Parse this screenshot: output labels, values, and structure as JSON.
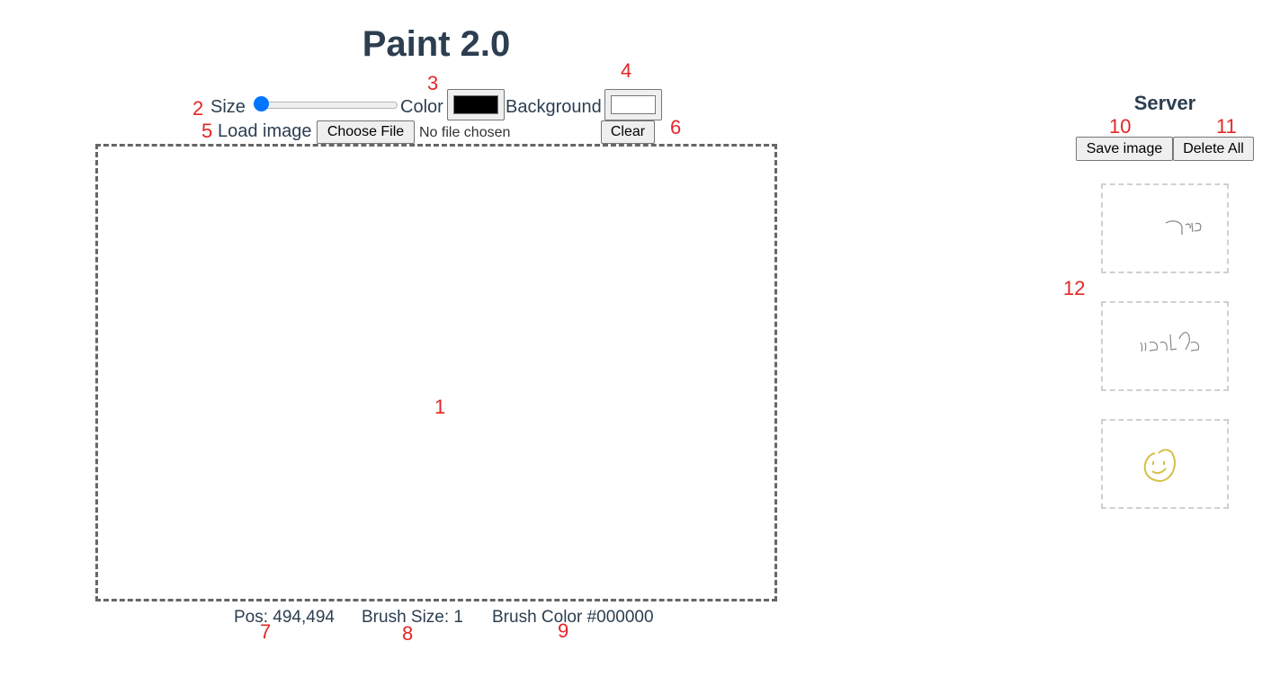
{
  "app": {
    "title": "Paint 2.0"
  },
  "toolbar": {
    "size_label": "Size",
    "brush_size_value": 1,
    "color_label": "Color",
    "brush_color": "#000000",
    "background_label": "Background",
    "background_color": "#ffffff",
    "load_image_label": "Load image",
    "choose_file_label": "Choose File",
    "file_status": "No file chosen",
    "clear_label": "Clear"
  },
  "status_bar": {
    "position": "Pos: 494,494",
    "brush_size": "Brush Size: 1",
    "brush_color": "Brush Color #000000"
  },
  "server": {
    "title": "Server",
    "save_label": "Save image",
    "delete_all_label": "Delete All",
    "thumbnails": [
      {
        "stroke_color": "#8a8a8a"
      },
      {
        "stroke_color": "#8a8a8a"
      },
      {
        "stroke_color": "#d4c14a"
      }
    ]
  },
  "annotations": {
    "canvas": "1",
    "size": "2",
    "color": "3",
    "background": "4",
    "load_image": "5",
    "clear": "6",
    "position": "7",
    "brush_size": "8",
    "brush_color": "9",
    "save_image": "10",
    "delete_all": "11",
    "thumbnails": "12"
  }
}
